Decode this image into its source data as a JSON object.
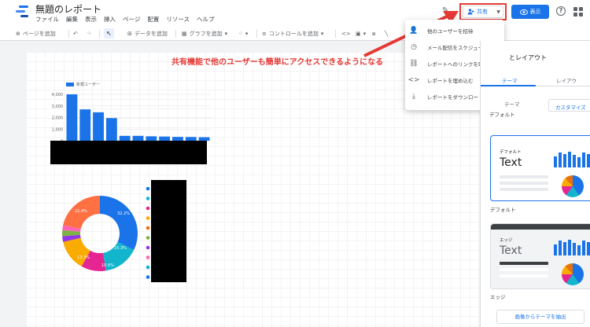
{
  "app": {
    "title": "無題のレポート",
    "menu": [
      "ファイル",
      "編集",
      "表示",
      "挿入",
      "ページ",
      "配置",
      "リソース",
      "ヘルプ"
    ]
  },
  "header": {
    "share_label": "共有",
    "view_label": "表示",
    "accent": "#1a73e8",
    "highlight": "#e53935"
  },
  "toolbar": {
    "add_page": "ページを追加",
    "add_data": "データを追加",
    "add_chart": "グラフを追加",
    "add_control": "コントロールを追加"
  },
  "annotation": "共有機能で他のユーザーも簡単にアクセスできるようになる",
  "share_menu": [
    {
      "icon": "person-add-icon",
      "label": "他のユーザーを招待"
    },
    {
      "icon": "schedule-icon",
      "label": "メール配信をスケジュール"
    },
    {
      "icon": "link-icon",
      "label": "レポートへのリンクを取得"
    },
    {
      "icon": "code-icon",
      "label": "レポートを埋め込む"
    },
    {
      "icon": "download-icon",
      "label": "レポートをダウンロード"
    }
  ],
  "panel": {
    "title": "とレイアウト",
    "tab_theme": "テーマ",
    "tab_layout": "レイアウ",
    "sub_theme": "テーマ",
    "sub_default": "デフォルト",
    "customize": "カスタマイズ",
    "themes": [
      {
        "name": "デフォルト",
        "label": "デフォルト",
        "text": "Text"
      },
      {
        "name": "エッジ",
        "label": "エッジ",
        "text": "Text"
      }
    ],
    "extract": "画像からテーマを抽出"
  },
  "chart_data": [
    {
      "type": "bar",
      "legend": "新規ユーザー",
      "series": [
        {
          "name": "新規ユーザー",
          "values": [
            4200,
            2700,
            2450,
            1950,
            420,
            420,
            380,
            360,
            330,
            320,
            300
          ]
        }
      ],
      "ylim": [
        0,
        4000
      ],
      "yticks": [
        "0",
        "1,000",
        "2,000",
        "3,000",
        "4,000"
      ],
      "color": "#1a73e8"
    },
    {
      "type": "pie",
      "donut": true,
      "slice_labels": [
        "32.2%",
        "15.3%",
        "10.6%",
        "13.3%",
        "21.4%"
      ],
      "slices": [
        {
          "value": 32.2,
          "color": "#1a73e8"
        },
        {
          "value": 15.3,
          "color": "#12b5cb"
        },
        {
          "value": 10.6,
          "color": "#e52592"
        },
        {
          "value": 13.3,
          "color": "#f9ab00"
        },
        {
          "value": 2.5,
          "color": "#9334e6"
        },
        {
          "value": 2.5,
          "color": "#7cb342"
        },
        {
          "value": 2.2,
          "color": "#ff63b8"
        },
        {
          "value": 21.4,
          "color": "#ff7043"
        }
      ],
      "legend_colors": [
        "#1a73e8",
        "#12b5cb",
        "#e52592",
        "#f9ab00",
        "#e8710a",
        "#7cb342",
        "#9334e6",
        "#ff63b8",
        "#12b5cb",
        "#1a73e8"
      ]
    }
  ]
}
